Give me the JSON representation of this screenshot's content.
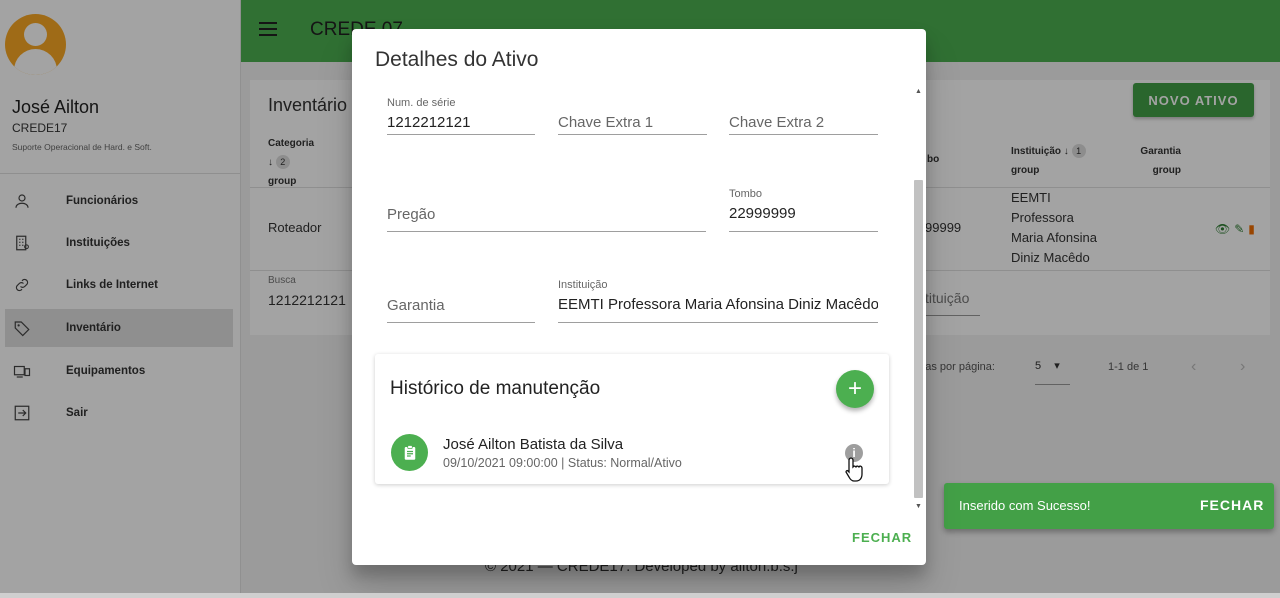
{
  "app": {
    "title": "CREDE 07",
    "footer": "© 2021 — CREDE17. Developed by ailton.b.s.j"
  },
  "sidebar": {
    "user_name": "José Ailton",
    "user_org": "CREDE17",
    "user_role": "Suporte Operacional de Hard. e Soft.",
    "items": [
      {
        "label": "Funcionários",
        "icon": "person-icon"
      },
      {
        "label": "Instituições",
        "icon": "building-icon"
      },
      {
        "label": "Links de Internet",
        "icon": "link-icon"
      },
      {
        "label": "Inventário",
        "icon": "tag-icon"
      },
      {
        "label": "Equipamentos",
        "icon": "devices-icon"
      },
      {
        "label": "Sair",
        "icon": "logout-icon"
      }
    ],
    "active_index": 3
  },
  "inventory": {
    "title": "Inventário",
    "new_button": "NOVO ATIVO",
    "headers": {
      "categoria": "Categoria",
      "categoria_badge": "2",
      "group": "group",
      "tombo_partial": "bo",
      "instituicao": "Instituição",
      "instituicao_badge": "1",
      "garantia": "Garantia"
    },
    "row": {
      "categoria": "Roteador",
      "tombo_partial": "99999",
      "instituicao_lines": [
        "EEMTI",
        "Professora",
        "Maria Afonsina",
        "Diniz Macêdo"
      ]
    },
    "search_label": "Busca",
    "search_value": "1212212121",
    "instituicao_filter": "tituição",
    "rows_per_page_label": "nhas por página:",
    "rows_per_page_value": "5",
    "range": "1-1 de 1"
  },
  "dialog": {
    "title": "Detalhes do Ativo",
    "fields": {
      "serial_label": "Num. de série",
      "serial_value": "1212212121",
      "extra1_placeholder": "Chave Extra 1",
      "extra2_placeholder": "Chave Extra 2",
      "pregao_placeholder": "Pregão",
      "tombo_label": "Tombo",
      "tombo_value": "22999999",
      "garantia_placeholder": "Garantia",
      "instituicao_label": "Instituição",
      "instituicao_value": "EEMTI Professora Maria Afonsina Diniz Macêdo"
    },
    "history": {
      "title": "Histórico de manutenção",
      "entries": [
        {
          "name": "José Ailton Batista da Silva",
          "meta": "09/10/2021 09:00:00 | Status: Normal/Ativo"
        }
      ]
    },
    "close_label": "FECHAR"
  },
  "snackbar": {
    "message": "Inserido com Sucesso!",
    "action": "FECHAR"
  },
  "colors": {
    "primary": "#4caf50",
    "avatar": "#f9a825"
  }
}
